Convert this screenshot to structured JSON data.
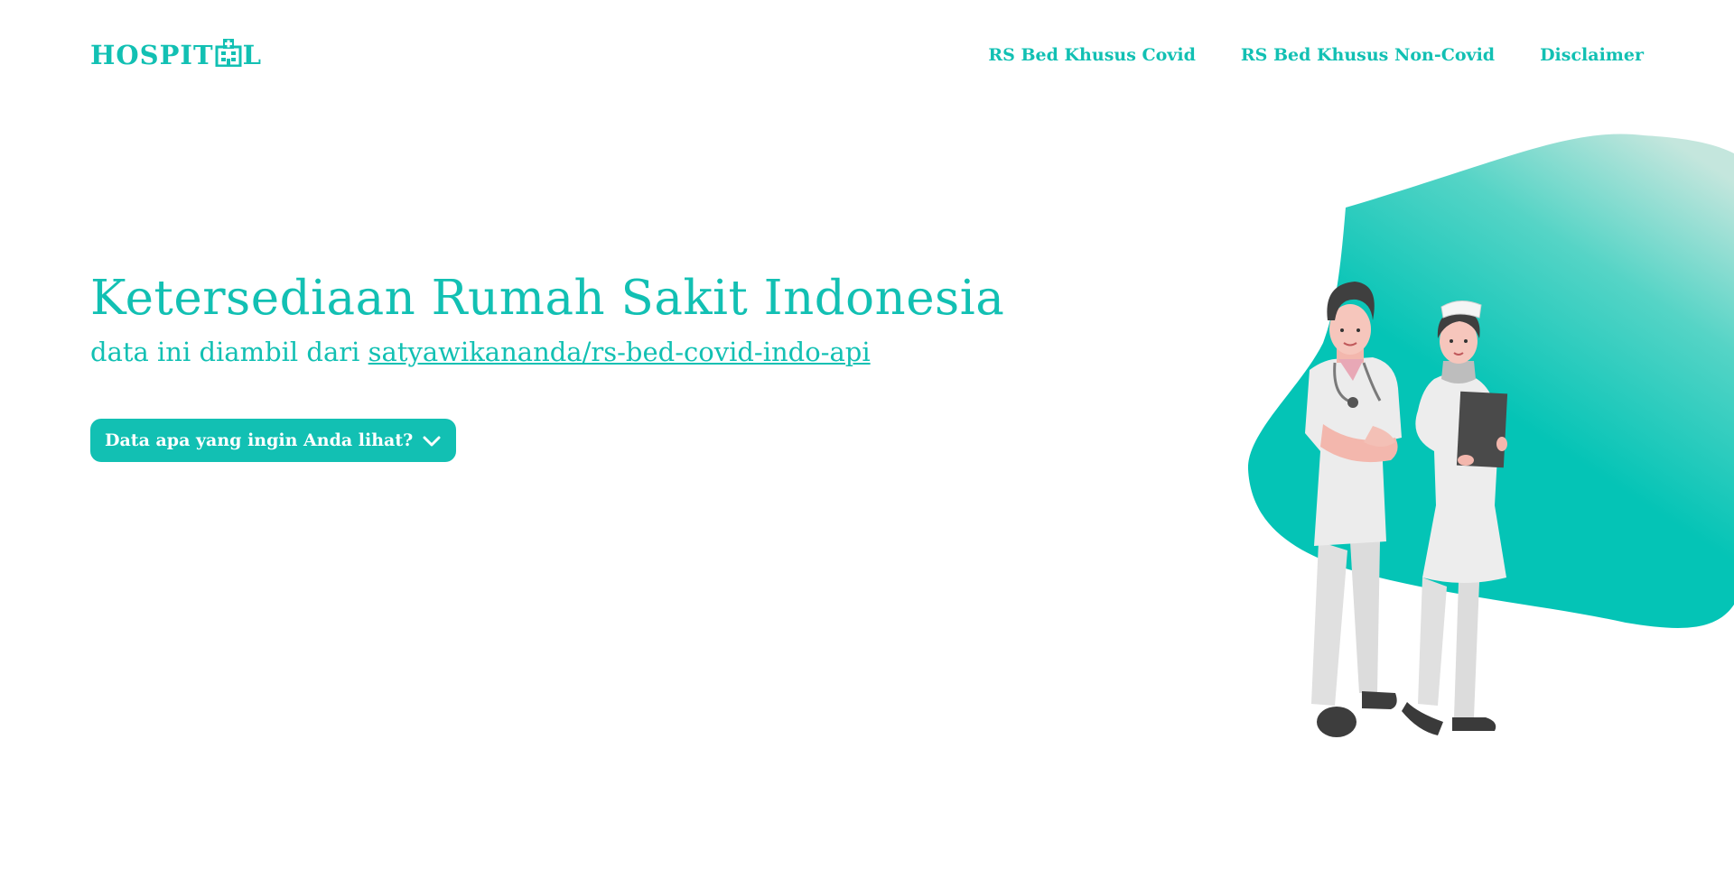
{
  "header": {
    "logo_text_left": "HOSPIT",
    "logo_text_right": "L",
    "nav": [
      {
        "label": "RS Bed Khusus Covid"
      },
      {
        "label": "RS Bed Khusus Non-Covid"
      },
      {
        "label": "Disclaimer"
      }
    ]
  },
  "hero": {
    "title": "Ketersediaan Rumah Sakit Indonesia",
    "subtitle_prefix": "data ini diambil dari ",
    "subtitle_link": "satyawikananda/rs-bed-covid-indo-api",
    "dropdown_label": "Data apa yang ingin Anda lihat?"
  },
  "colors": {
    "accent": "#12c0b3",
    "background": "#ffffff",
    "blob_top": "#bfe6dc",
    "blob_bottom": "#05c4b6"
  },
  "icons": {
    "logo_icon": "hospital-building-icon",
    "dropdown_icon": "chevron-down-icon"
  }
}
